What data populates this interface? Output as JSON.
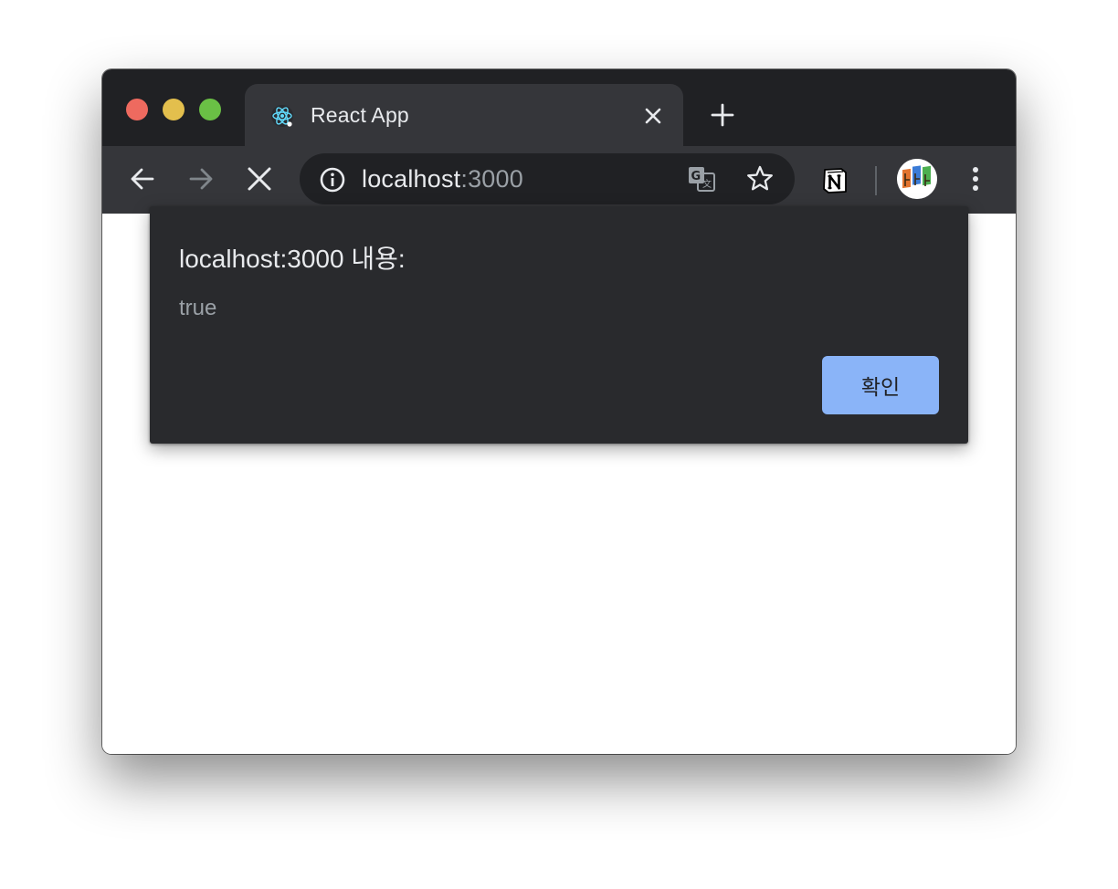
{
  "window": {
    "traffic_lights": [
      "close",
      "minimize",
      "zoom"
    ]
  },
  "tab": {
    "title": "React App",
    "favicon": "react-logo-icon",
    "close_icon": "close-icon"
  },
  "new_tab_icon": "plus-icon",
  "toolbar": {
    "back_icon": "arrow-left-icon",
    "forward_icon": "arrow-right-icon",
    "stop_icon": "close-icon",
    "site_info_icon": "info-icon",
    "url_host": "localhost",
    "url_port": ":3000",
    "translate_icon": "translate-icon",
    "bookmark_icon": "star-icon",
    "extension_icon": "notion-icon",
    "profile_icon": "avatar",
    "menu_icon": "more-vertical-icon"
  },
  "dialog": {
    "title": "localhost:3000 내용:",
    "message": "true",
    "ok_label": "확인"
  },
  "colors": {
    "titlebar": "#202124",
    "toolbar": "#35363a",
    "dialog_bg": "#292a2d",
    "button_accent": "#8ab4f8"
  }
}
